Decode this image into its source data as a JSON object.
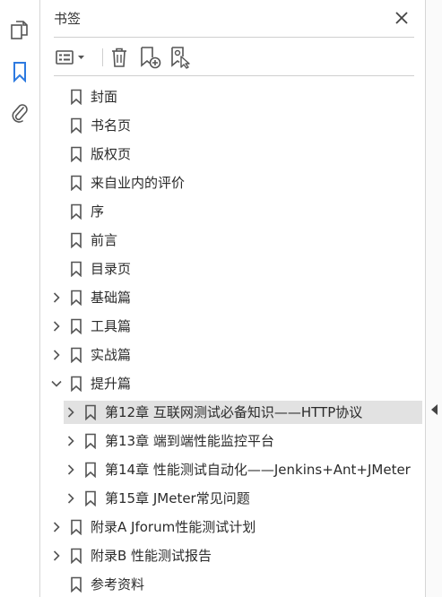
{
  "panel": {
    "title": "书签"
  },
  "rail": {
    "items": [
      {
        "name": "pages-icon"
      },
      {
        "name": "bookmark-icon",
        "active": true
      },
      {
        "name": "attachment-icon"
      }
    ]
  },
  "toolbar": {
    "buttons": [
      "options-menu-icon",
      "trash-icon",
      "new-bookmark-icon",
      "bookmark-from-selection-icon"
    ]
  },
  "colors": {
    "accent": "#2d7ae0",
    "icon": "#555555",
    "selected_row": "#e2e2e2"
  },
  "bookmarks": [
    {
      "label": "封面",
      "level": 0,
      "expandable": false
    },
    {
      "label": "书名页",
      "level": 0,
      "expandable": false
    },
    {
      "label": "版权页",
      "level": 0,
      "expandable": false
    },
    {
      "label": "来自业内的评价",
      "level": 0,
      "expandable": false
    },
    {
      "label": "序",
      "level": 0,
      "expandable": false
    },
    {
      "label": "前言",
      "level": 0,
      "expandable": false
    },
    {
      "label": "目录页",
      "level": 0,
      "expandable": false
    },
    {
      "label": "基础篇",
      "level": 0,
      "expandable": true,
      "expanded": false
    },
    {
      "label": "工具篇",
      "level": 0,
      "expandable": true,
      "expanded": false
    },
    {
      "label": "实战篇",
      "level": 0,
      "expandable": true,
      "expanded": false
    },
    {
      "label": "提升篇",
      "level": 0,
      "expandable": true,
      "expanded": true
    },
    {
      "label": "第12章  互联网测试必备知识——HTTP协议",
      "level": 1,
      "expandable": true,
      "expanded": false,
      "selected": true
    },
    {
      "label": "第13章  端到端性能监控平台",
      "level": 1,
      "expandable": true,
      "expanded": false
    },
    {
      "label": "第14章  性能测试自动化——Jenkins+Ant+JMeter",
      "level": 1,
      "expandable": true,
      "expanded": false
    },
    {
      "label": "第15章  JMeter常见问题",
      "level": 1,
      "expandable": true,
      "expanded": false
    },
    {
      "label": "附录A  Jforum性能测试计划",
      "level": 0,
      "expandable": true,
      "expanded": false
    },
    {
      "label": "附录B  性能测试报告",
      "level": 0,
      "expandable": true,
      "expanded": false
    },
    {
      "label": "参考资料",
      "level": 0,
      "expandable": false
    }
  ]
}
